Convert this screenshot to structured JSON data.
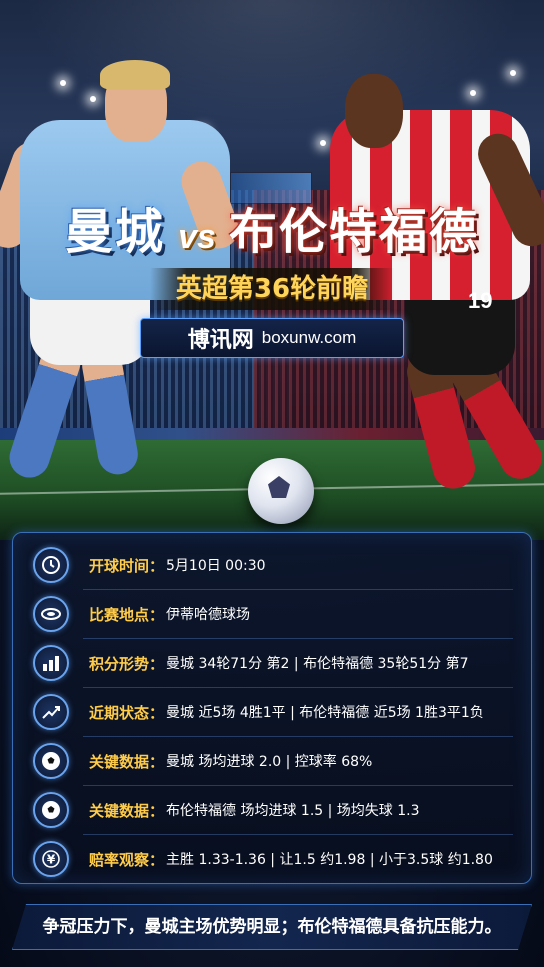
{
  "title": {
    "home_team": "曼城",
    "vs": "vs",
    "away_team": "布伦特福德"
  },
  "round_label": "英超第36轮前瞻",
  "brand": {
    "name": "博讯网",
    "url": "boxunw.com"
  },
  "player_number": "19",
  "info_rows": [
    {
      "icon": "clock-icon",
      "label": "开球时间：",
      "value": "5月10日 00:30"
    },
    {
      "icon": "stadium-icon",
      "label": "比赛地点：",
      "value": "伊蒂哈德球场"
    },
    {
      "icon": "bar-chart-icon",
      "label": "积分形势：",
      "value": "曼城 34轮71分 第2 | 布伦特福德 35轮51分 第7"
    },
    {
      "icon": "trend-line-icon",
      "label": "近期状态：",
      "value": "曼城 近5场 4胜1平 | 布伦特福德 近5场 1胜3平1负"
    },
    {
      "icon": "soccer-ball-icon",
      "label": "关键数据：",
      "value": "曼城 场均进球 2.0 | 控球率 68%"
    },
    {
      "icon": "soccer-ball-icon",
      "label": "关键数据：",
      "value": "布伦特福德 场均进球 1.5 | 场均失球 1.3"
    },
    {
      "icon": "yen-icon",
      "label": "赔率观察：",
      "value": "主胜 1.33-1.36 | 让1.5 约1.98 | 小于3.5球 约1.80"
    }
  ],
  "tagline": "争冠压力下，曼城主场优势明显；布伦特福德具备抗压能力。"
}
